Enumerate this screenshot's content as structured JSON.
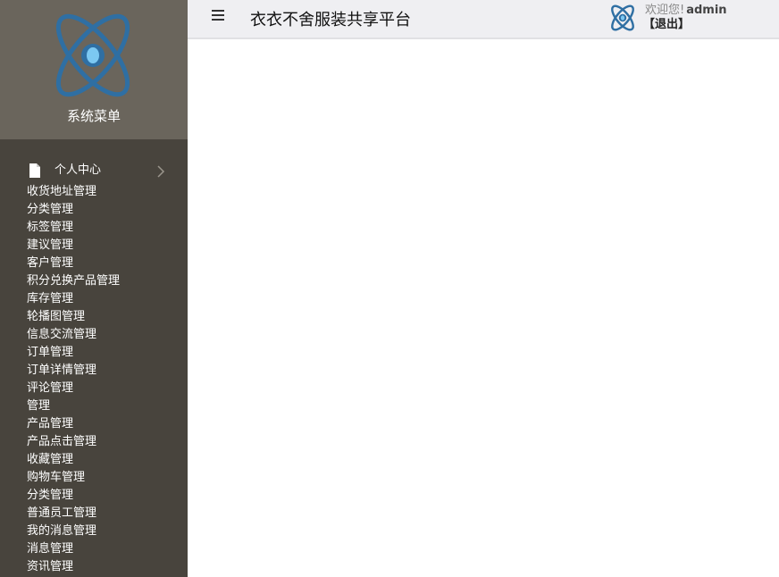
{
  "sidebar": {
    "title": "系统菜单",
    "logo_icon": "atom-logo-icon",
    "group": {
      "label": "个人中心",
      "icon": "document-icon",
      "expand_icon": "chevron-right-icon"
    },
    "items": [
      {
        "label": "收货地址管理"
      },
      {
        "label": "分类管理"
      },
      {
        "label": "标签管理"
      },
      {
        "label": "建议管理"
      },
      {
        "label": "客户管理"
      },
      {
        "label": "积分兑换产品管理"
      },
      {
        "label": "库存管理"
      },
      {
        "label": "轮播图管理"
      },
      {
        "label": "信息交流管理"
      },
      {
        "label": "订单管理"
      },
      {
        "label": "订单详情管理"
      },
      {
        "label": "评论管理"
      },
      {
        "label": "管理"
      },
      {
        "label": "产品管理"
      },
      {
        "label": "产品点击管理"
      },
      {
        "label": "收藏管理"
      },
      {
        "label": "购物车管理"
      },
      {
        "label": "分类管理"
      },
      {
        "label": "普通员工管理"
      },
      {
        "label": "我的消息管理"
      },
      {
        "label": "消息管理"
      },
      {
        "label": "资讯管理"
      }
    ]
  },
  "header": {
    "menu_icon": "hamburger-icon",
    "title": "衣衣不舍服装共享平台",
    "user": {
      "avatar_icon": "atom-logo-icon",
      "greeting": "欢迎您!",
      "username": "admin",
      "logout_label": "【退出】"
    }
  },
  "colors": {
    "sidebar_bg": "#48443d",
    "sidebar_header_bg": "#6a655c",
    "topbar_bg": "#efeff2",
    "logo_blue": "#2f6fa3",
    "logo_core": "#7cc8f2"
  }
}
